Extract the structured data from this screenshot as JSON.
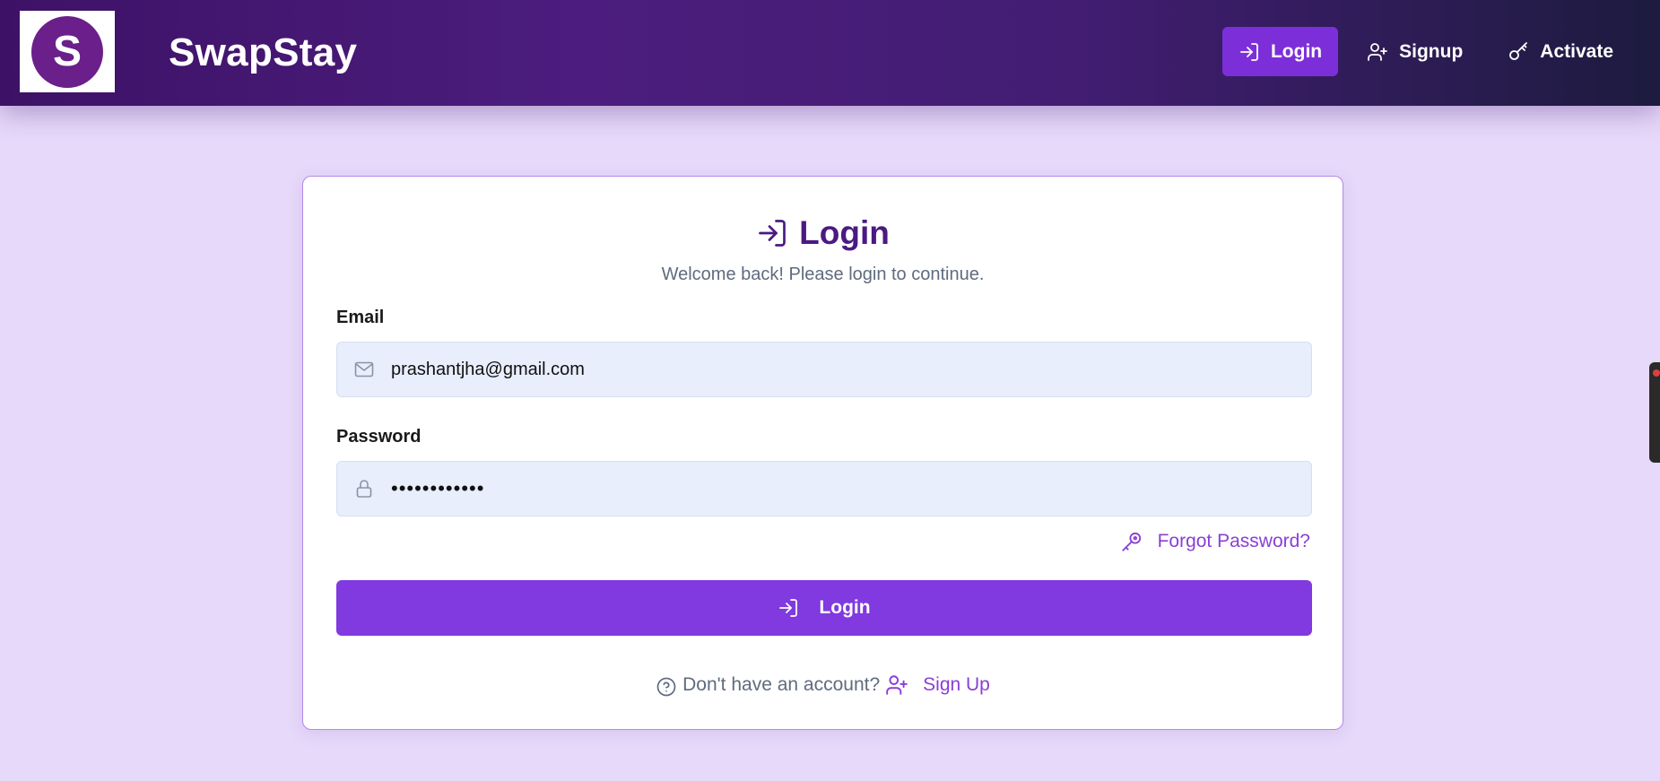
{
  "brand": {
    "logo_letter": "S",
    "name": "SwapStay"
  },
  "nav": {
    "items": [
      {
        "label": "Login",
        "icon": "login-icon",
        "active": true
      },
      {
        "label": "Signup",
        "icon": "user-plus-icon",
        "active": false
      },
      {
        "label": "Activate",
        "icon": "key-icon",
        "active": false
      }
    ]
  },
  "login_form": {
    "title": "Login",
    "subtitle": "Welcome back! Please login to continue.",
    "email": {
      "label": "Email",
      "value": "prashantjha@gmail.com",
      "icon": "envelope-icon"
    },
    "password": {
      "label": "Password",
      "value": "••••••••••••",
      "icon": "lock-icon"
    },
    "forgot_password": "Forgot Password?",
    "submit_label": "Login",
    "no_account_text": "Don't have an account?",
    "signup_link": "Sign Up"
  },
  "colors": {
    "accent": "#8139e0",
    "title": "#4a1a82",
    "link": "#8a3fd6",
    "page_background": "#e7d9fa",
    "input_background": "#e8eefc"
  }
}
